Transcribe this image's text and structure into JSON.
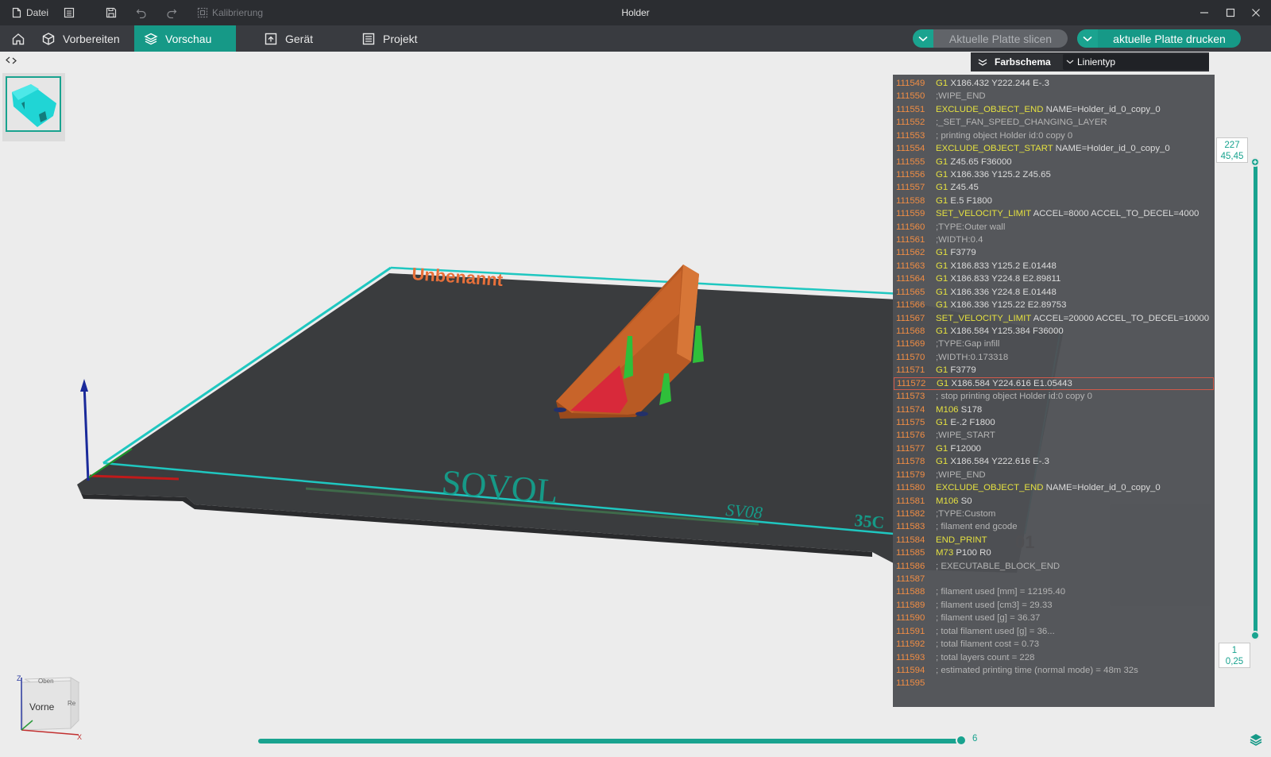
{
  "titlebar": {
    "file_label": "Datei",
    "calibration_label": "Kalibrierung",
    "window_title": "Holder"
  },
  "tabs": [
    {
      "label": "Vorbereiten",
      "icon": "cube-icon"
    },
    {
      "label": "Vorschau",
      "icon": "layers-icon"
    },
    {
      "label": "Gerät",
      "icon": "device-icon"
    },
    {
      "label": "Projekt",
      "icon": "project-icon"
    }
  ],
  "actions": {
    "slice_label": "Aktuelle Platte slicen",
    "print_label": "aktuelle Platte drucken"
  },
  "colors": {
    "accent": "#169987",
    "bed": "#3a3c3e",
    "bed_border": "#1fc7c0",
    "model": "#c8642a",
    "support": "#2fbf3a"
  },
  "color_scheme": {
    "label": "Farbschema",
    "selected": "Linientyp"
  },
  "gcode_lines": [
    {
      "n": "111549",
      "cmd": "G1",
      "args": " X186.432 Y222.244 E-.3"
    },
    {
      "n": "111550",
      "comment": ";WIPE_END"
    },
    {
      "n": "111551",
      "cmd": "EXCLUDE_OBJECT_END",
      "args": " NAME=Holder_id_0_copy_0"
    },
    {
      "n": "111552",
      "comment": ";_SET_FAN_SPEED_CHANGING_LAYER"
    },
    {
      "n": "111553",
      "comment": "; printing object Holder id:0 copy 0"
    },
    {
      "n": "111554",
      "cmd": "EXCLUDE_OBJECT_START",
      "args": " NAME=Holder_id_0_copy_0"
    },
    {
      "n": "111555",
      "cmd": "G1",
      "args": " Z45.65 F36000"
    },
    {
      "n": "111556",
      "cmd": "G1",
      "args": " X186.336 Y125.2 Z45.65"
    },
    {
      "n": "111557",
      "cmd": "G1",
      "args": " Z45.45"
    },
    {
      "n": "111558",
      "cmd": "G1",
      "args": " E.5 F1800"
    },
    {
      "n": "111559",
      "cmd": "SET_VELOCITY_LIMIT",
      "args": " ACCEL=8000 ACCEL_TO_DECEL=4000"
    },
    {
      "n": "111560",
      "comment": ";TYPE:Outer wall"
    },
    {
      "n": "111561",
      "comment": ";WIDTH:0.4"
    },
    {
      "n": "111562",
      "cmd": "G1",
      "args": " F3779"
    },
    {
      "n": "111563",
      "cmd": "G1",
      "args": " X186.833 Y125.2 E.01448"
    },
    {
      "n": "111564",
      "cmd": "G1",
      "args": " X186.833 Y224.8 E2.89811"
    },
    {
      "n": "111565",
      "cmd": "G1",
      "args": " X186.336 Y224.8 E.01448"
    },
    {
      "n": "111566",
      "cmd": "G1",
      "args": " X186.336 Y125.22 E2.89753"
    },
    {
      "n": "111567",
      "cmd": "SET_VELOCITY_LIMIT",
      "args": " ACCEL=20000 ACCEL_TO_DECEL=10000"
    },
    {
      "n": "111568",
      "cmd": "G1",
      "args": " X186.584 Y125.384 F36000"
    },
    {
      "n": "111569",
      "comment": ";TYPE:Gap infill"
    },
    {
      "n": "111570",
      "comment": ";WIDTH:0.173318"
    },
    {
      "n": "111571",
      "cmd": "G1",
      "args": " F3779"
    },
    {
      "n": "111572",
      "cmd": "G1",
      "args": " X186.584 Y224.616 E1.05443",
      "highlight": true
    },
    {
      "n": "111573",
      "comment": "; stop printing object Holder id:0 copy 0"
    },
    {
      "n": "111574",
      "cmd": "M106",
      "args": " S178"
    },
    {
      "n": "111575",
      "cmd": "G1",
      "args": " E-.2 F1800"
    },
    {
      "n": "111576",
      "comment": ";WIPE_START"
    },
    {
      "n": "111577",
      "cmd": "G1",
      "args": " F12000"
    },
    {
      "n": "111578",
      "cmd": "G1",
      "args": " X186.584 Y222.616 E-.3"
    },
    {
      "n": "111579",
      "comment": ";WIPE_END"
    },
    {
      "n": "111580",
      "cmd": "EXCLUDE_OBJECT_END",
      "args": " NAME=Holder_id_0_copy_0"
    },
    {
      "n": "111581",
      "cmd": "M106",
      "args": " S0"
    },
    {
      "n": "111582",
      "comment": ";TYPE:Custom"
    },
    {
      "n": "111583",
      "comment": "; filament end gcode"
    },
    {
      "n": "111584",
      "cmd": "END_PRINT",
      "args": ""
    },
    {
      "n": "111585",
      "cmd": "M73",
      "args": " P100 R0"
    },
    {
      "n": "111586",
      "comment": "; EXECUTABLE_BLOCK_END"
    },
    {
      "n": "111587",
      "comment": ""
    },
    {
      "n": "111588",
      "comment": "; filament used [mm] = 12195.40"
    },
    {
      "n": "111589",
      "comment": "; filament used [cm3] = 29.33"
    },
    {
      "n": "111590",
      "comment": "; filament used [g] = 36.37"
    },
    {
      "n": "111591",
      "comment": "; total filament used [g] = 36..."
    },
    {
      "n": "111592",
      "comment": "; total filament cost = 0.73"
    },
    {
      "n": "111593",
      "comment": "; total layers count = 228"
    },
    {
      "n": "111594",
      "comment": "; estimated printing time (normal mode) = 48m 32s"
    },
    {
      "n": "111595",
      "comment": ""
    }
  ],
  "layer_slider": {
    "top_layer": "227",
    "top_height": "45,45",
    "bottom_layer": "1",
    "bottom_height": "0,25"
  },
  "move_slider": {
    "value": "6"
  },
  "bed": {
    "plate_name": "Unbenannt",
    "brand": "SOVOL",
    "model": "SV08",
    "size_text": "35C",
    "plate_number": "01"
  },
  "navcube": {
    "front_label": "Vorne",
    "top_label": "Oben",
    "right_label": "Re",
    "axis_z": "Z",
    "axis_x": "X"
  }
}
